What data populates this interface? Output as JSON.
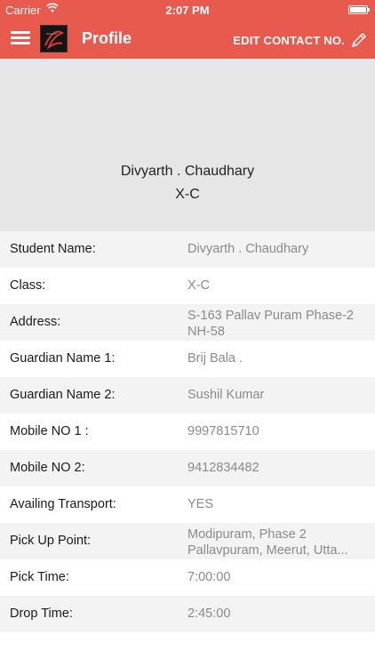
{
  "status": {
    "carrier": "Carrier",
    "time": "2:07 PM"
  },
  "nav": {
    "title": "Profile",
    "edit_label": "EDIT CONTACT NO."
  },
  "header": {
    "name": "Divyarth . Chaudhary",
    "class": "X-C"
  },
  "fields": [
    {
      "label": "Student Name:",
      "value": "Divyarth . Chaudhary"
    },
    {
      "label": "Class:",
      "value": "X-C"
    },
    {
      "label": "Address:",
      "value_line1": "S-163 Pallav Puram Phase-2",
      "value_line2": "NH-58"
    },
    {
      "label": "Guardian Name 1:",
      "value": "Brij Bala  ."
    },
    {
      "label": "Guardian Name 2:",
      "value": "Sushil  Kumar"
    },
    {
      "label": "Mobile NO 1 :",
      "value": "9997815710"
    },
    {
      "label": "Mobile NO 2:",
      "value": "9412834482"
    },
    {
      "label": "Availing Transport:",
      "value": "YES"
    },
    {
      "label": "Pick Up Point:",
      "value_line1": "Modipuram, Phase 2",
      "value_line2": "Pallavpuram, Meerut, Utta..."
    },
    {
      "label": "Pick Time:",
      "value": "7:00:00"
    },
    {
      "label": "Drop Time:",
      "value": "2:45:00"
    }
  ],
  "colors": {
    "accent": "#e8594e",
    "header_bg": "#e6e6e6",
    "alt_row": "#f3f3f3",
    "value_text": "#8a8a8a"
  }
}
